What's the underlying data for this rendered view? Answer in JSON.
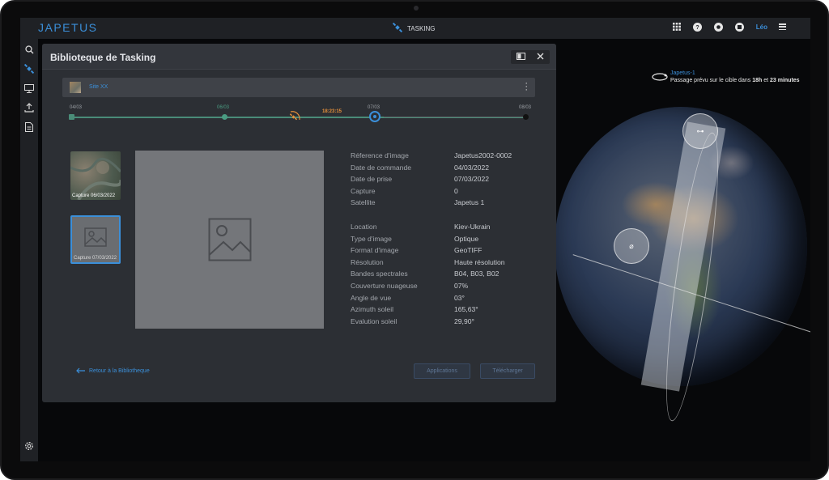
{
  "app": {
    "logo": "JAPETUS",
    "module_label": "TASKING",
    "user_name": "Léo"
  },
  "sidebar": {
    "items": [
      "search-icon",
      "satellite-icon",
      "monitor-icon",
      "upload-icon",
      "document-icon"
    ],
    "bottom_item": "settings-icon"
  },
  "satellite_panel": {
    "name": "Japetus-1",
    "pass_prefix": "Passage prévu sur le cible dans",
    "pass_hours": "18h",
    "pass_and": "et",
    "pass_minutes": "23 minutes"
  },
  "modal": {
    "title": "Biblioteque de Tasking",
    "site_name": "Site XX",
    "timeline": {
      "start_date": "04/03",
      "order_date": "06/03",
      "current_time": "18:23:15",
      "capture_date": "07/03",
      "end_date": "08/03"
    },
    "thumbnails": [
      {
        "caption": "Capture 06/03/2022"
      },
      {
        "caption": "Capture 07/03/2022"
      }
    ],
    "metadata_main": [
      {
        "key": "Réference d'image",
        "value": "Japetus2002-0002"
      },
      {
        "key": "Date de commande",
        "value": "04/03/2022"
      },
      {
        "key": "Date de prise",
        "value": "07/03/2022"
      },
      {
        "key": "Capture",
        "value": "0"
      },
      {
        "key": "Satellite",
        "value": "Japetus 1"
      }
    ],
    "metadata_details": [
      {
        "key": "Location",
        "value": "Kiev-Ukrain"
      },
      {
        "key": "Type d'image",
        "value": "Optique"
      },
      {
        "key": "Format d'image",
        "value": "GeoTIFF"
      },
      {
        "key": "Résolution",
        "value": "Haute résolution"
      },
      {
        "key": "Bandes spectrales",
        "value": "B04, B03, B02"
      },
      {
        "key": "Couverture nuageuse",
        "value": "07%"
      },
      {
        "key": "Angle de vue",
        "value": "03°"
      },
      {
        "key": "Azimuth soleil",
        "value": "165,63°"
      },
      {
        "key": "Evalution soleil",
        "value": "29,90°"
      }
    ],
    "back_label": "Retour à la Bibliotheque",
    "applications_label": "Applications",
    "download_label": "Télécharger"
  },
  "colors": {
    "accent": "#3b8fd9",
    "timeline_done": "#4a8c78",
    "time_marker": "#e8913a"
  }
}
